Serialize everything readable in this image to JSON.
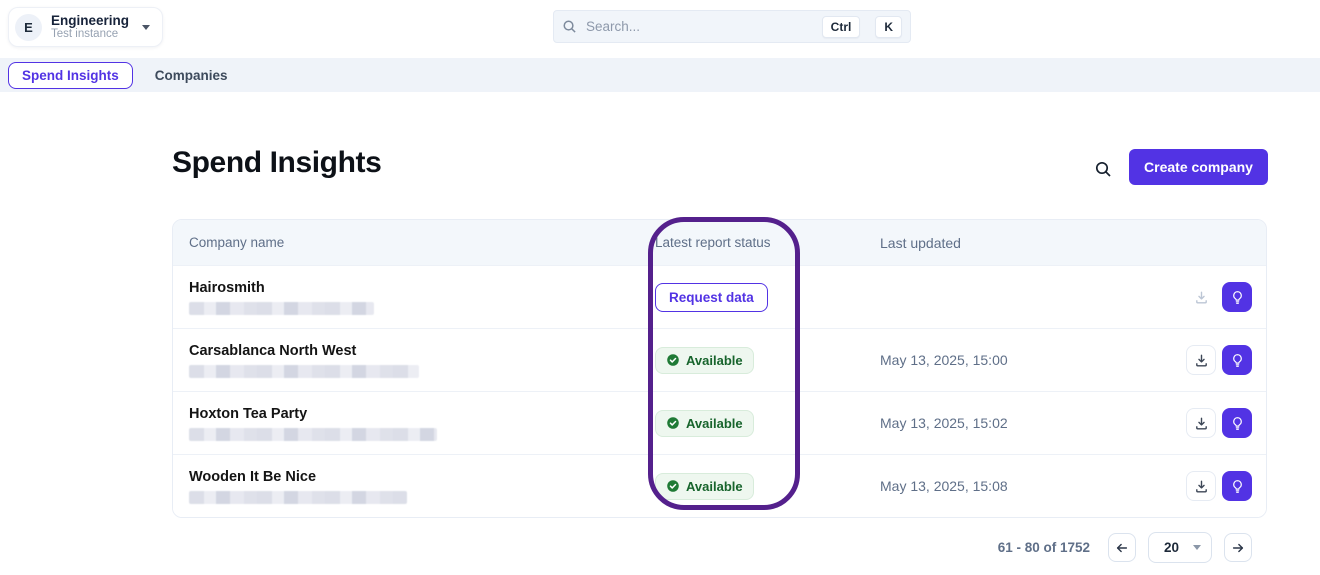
{
  "workspace": {
    "avatar_initial": "E",
    "name": "Engineering",
    "subtitle": "Test instance"
  },
  "search": {
    "placeholder": "Search...",
    "shortcut_keys": [
      "Ctrl",
      "K"
    ]
  },
  "nav": {
    "tabs": [
      {
        "label": "Spend Insights",
        "active": true
      },
      {
        "label": "Companies",
        "active": false
      }
    ]
  },
  "page": {
    "title": "Spend Insights",
    "create_button_label": "Create company"
  },
  "table": {
    "columns": [
      "Company name",
      "Latest report status",
      "Last updated"
    ],
    "rows": [
      {
        "name": "Hairosmith",
        "status": "Request data",
        "status_type": "request",
        "last_updated": "",
        "download_enabled": false
      },
      {
        "name": "Carsablanca North West",
        "status": "Available",
        "status_type": "available",
        "last_updated": "May 13, 2025, 15:00",
        "download_enabled": true
      },
      {
        "name": "Hoxton Tea Party",
        "status": "Available",
        "status_type": "available",
        "last_updated": "May 13, 2025, 15:02",
        "download_enabled": true
      },
      {
        "name": "Wooden It Be Nice",
        "status": "Available",
        "status_type": "available",
        "last_updated": "May 13, 2025, 15:08",
        "download_enabled": true
      }
    ]
  },
  "pagination": {
    "range_label": "61 - 80 of 1752",
    "page_size": "20"
  },
  "annotation": {
    "target": "Latest report status column",
    "color": "#54208c"
  },
  "colors": {
    "accent_purple": "#5233e4",
    "annotation_purple": "#54208c",
    "available_green": "#1f7a35",
    "header_bg": "#f3f7fb",
    "tabstrip_bg": "#eff3f9"
  }
}
